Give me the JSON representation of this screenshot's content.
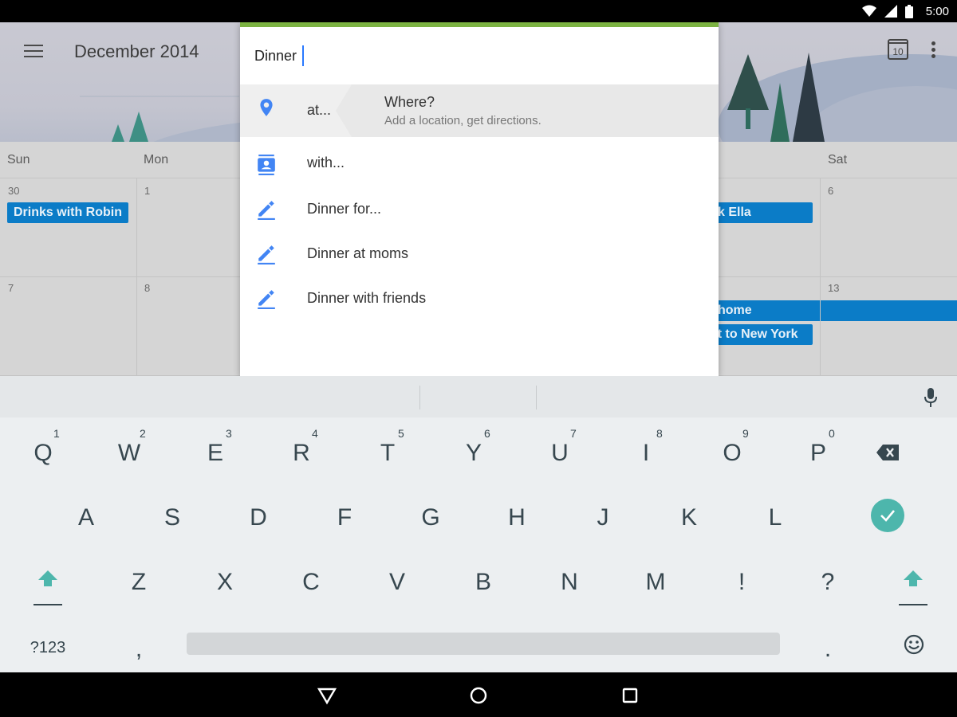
{
  "status_bar": {
    "time": "5:00"
  },
  "calendar": {
    "title": "December 2014",
    "today_badge": "10",
    "days": [
      "Sun",
      "Mon",
      "Sat"
    ],
    "week1": {
      "sun_num": "30",
      "mon_num": "1",
      "sat_num": "6",
      "events": {
        "drinks": "Drinks with Robin",
        "ella": "k Ella"
      }
    },
    "week2": {
      "sun_num": "7",
      "mon_num": "8",
      "sat_num": "13",
      "events": {
        "home": "home",
        "flight": "ht to New York"
      }
    }
  },
  "dialog": {
    "title_value": "Dinner",
    "accent_color": "#7cb342",
    "location": {
      "label": "at...",
      "title": "Where?",
      "subtitle": "Add a location, get directions."
    },
    "suggestions": [
      {
        "label": "with...",
        "icon": "contact-icon"
      },
      {
        "label": "Dinner for...",
        "icon": "pencil-icon"
      },
      {
        "label": "Dinner at moms",
        "icon": "pencil-icon"
      },
      {
        "label": "Dinner with friends",
        "icon": "pencil-icon"
      }
    ]
  },
  "keyboard": {
    "row1": [
      {
        "ch": "Q",
        "num": "1"
      },
      {
        "ch": "W",
        "num": "2"
      },
      {
        "ch": "E",
        "num": "3"
      },
      {
        "ch": "R",
        "num": "4"
      },
      {
        "ch": "T",
        "num": "5"
      },
      {
        "ch": "Y",
        "num": "6"
      },
      {
        "ch": "U",
        "num": "7"
      },
      {
        "ch": "I",
        "num": "8"
      },
      {
        "ch": "O",
        "num": "9"
      },
      {
        "ch": "P",
        "num": "0"
      }
    ],
    "row2": [
      "A",
      "S",
      "D",
      "F",
      "G",
      "H",
      "J",
      "K",
      "L"
    ],
    "row3": [
      "Z",
      "X",
      "C",
      "V",
      "B",
      "N",
      "M",
      "!",
      "?"
    ],
    "symbols_label": "?123",
    "comma": ",",
    "period": ".",
    "accent_color": "#4db6ac"
  }
}
